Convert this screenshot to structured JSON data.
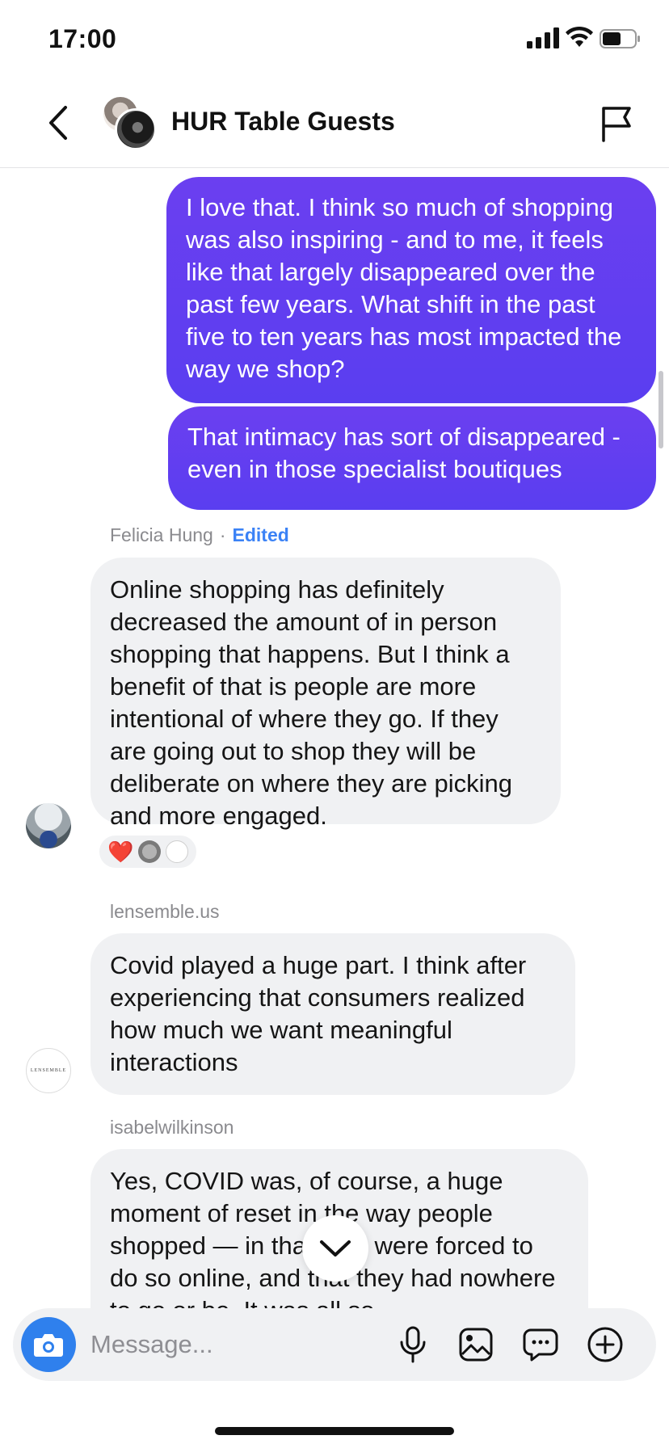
{
  "status_bar": {
    "time": "17:00"
  },
  "header": {
    "title": "HUR Table Guests"
  },
  "messages": [
    {
      "type": "sent",
      "text": "I love that. I think so much of shopping was also inspiring - and to me, it feels like that largely disappeared over the past few years. What shift in the past five to ten years has most impacted the way we shop?"
    },
    {
      "type": "sent",
      "text": "That intimacy has sort of disappeared - even in those specialist boutiques"
    },
    {
      "type": "received",
      "sender": "Felicia Hung",
      "separator": "·",
      "edited": "Edited",
      "text": "Online shopping has definitely decreased the amount of in person shopping that happens. But I think a benefit of that is people are more intentional of where they go. If they are going out to shop they will be deliberate on where they are picking and more engaged.",
      "reaction": "❤️"
    },
    {
      "type": "received",
      "sender": "lensemble.us",
      "text": "Covid played a huge part. I think after experiencing that consumers realized how much we want meaningful interactions",
      "avatar_text": "LENSEMBLE"
    },
    {
      "type": "received",
      "sender": "isabelwilkinson",
      "text": "Yes, COVID was, of course, a huge moment of reset in the way people shopped — in that they were forced to do so online, and that they had nowhere to go or be. It was all so"
    }
  ],
  "composer": {
    "placeholder": "Message..."
  },
  "colors": {
    "sent_bubble": "#5e3ff0",
    "received_bubble": "#f0f1f3",
    "accent_blue": "#2f80ed",
    "edited_blue": "#3b82f6"
  },
  "icons": [
    "back-chevron-icon",
    "flag-icon",
    "camera-icon",
    "microphone-icon",
    "gallery-icon",
    "sticker-icon",
    "plus-icon",
    "chevron-down-icon",
    "heart-icon"
  ]
}
